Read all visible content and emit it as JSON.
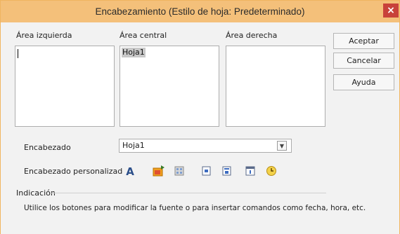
{
  "window": {
    "title": "Encabezamiento (Estilo de hoja: Predeterminado)",
    "close_label": "×"
  },
  "areas": {
    "left_label": "Área izquierda",
    "center_label": "Área central",
    "right_label": "Área derecha",
    "left_text": "",
    "center_text": "Hoja1",
    "right_text": ""
  },
  "buttons": {
    "accept": "Aceptar",
    "cancel": "Cancelar",
    "help": "Ayuda"
  },
  "header": {
    "label": "Encabezado",
    "selected": "Hoja1"
  },
  "custom_header": {
    "label": "Encabezado personalizado",
    "tools": [
      "text-attributes-icon",
      "insert-image-icon",
      "file-name-icon",
      "sheet-name-icon",
      "page-number-icon",
      "date-icon",
      "time-icon"
    ]
  },
  "hint": {
    "label": "Indicación",
    "text": "Utilice los botones para modificar la fuente o para insertar comandos como fecha, hora, etc."
  },
  "colors": {
    "titlebar": "#f4c07a",
    "close": "#c8423a"
  }
}
